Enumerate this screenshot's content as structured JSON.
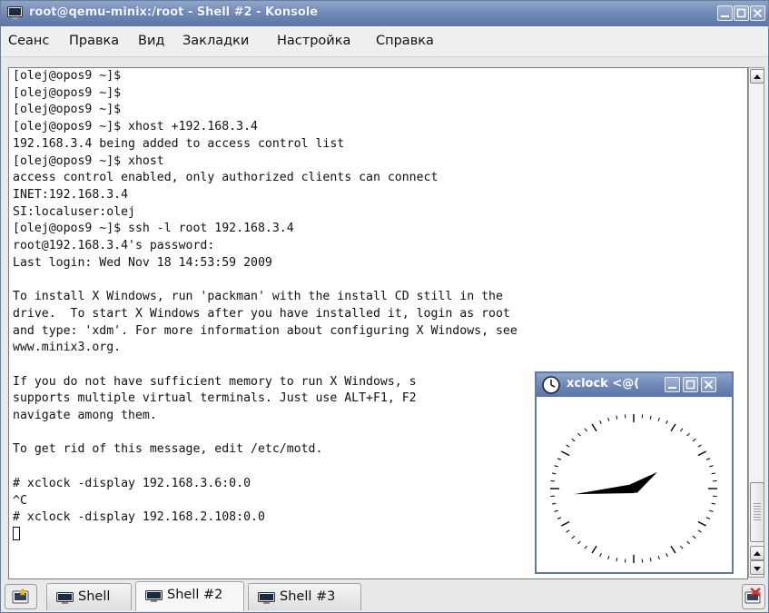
{
  "window": {
    "title": "root@qemu-minix:/root - Shell #2 - Konsole",
    "accent": "#6d86b3"
  },
  "menubar": {
    "items": [
      "Сеанс",
      "Правка",
      "Вид",
      "Закладки",
      "Настройка",
      "Справка"
    ]
  },
  "terminal": {
    "lines": [
      "[olej@opos9 ~]$",
      "[olej@opos9 ~]$",
      "[olej@opos9 ~]$",
      "[olej@opos9 ~]$ xhost +192.168.3.4",
      "192.168.3.4 being added to access control list",
      "[olej@opos9 ~]$ xhost",
      "access control enabled, only authorized clients can connect",
      "INET:192.168.3.4",
      "SI:localuser:olej",
      "[olej@opos9 ~]$ ssh -l root 192.168.3.4",
      "root@192.168.3.4's password:",
      "Last login: Wed Nov 18 14:53:59 2009",
      "",
      "To install X Windows, run 'packman' with the install CD still in the",
      "drive.  To start X Windows after you have installed it, login as root",
      "and type: 'xdm'. For more information about configuring X Windows, see",
      "www.minix3.org.",
      "",
      "If you do not have sufficient memory to run X Windows, s",
      "supports multiple virtual terminals. Just use ALT+F1, F2",
      "navigate among them.",
      "",
      "To get rid of this message, edit /etc/motd.",
      "",
      "# xclock -display 192.168.3.6:0.0",
      "^C",
      "# xclock -display 192.168.2.108:0.0"
    ]
  },
  "tabs": [
    {
      "label": "Shell",
      "active": false
    },
    {
      "label": "Shell #2",
      "active": true
    },
    {
      "label": "Shell #3",
      "active": false
    }
  ],
  "xclock": {
    "title": "xclock <@(",
    "time": "1:44"
  }
}
